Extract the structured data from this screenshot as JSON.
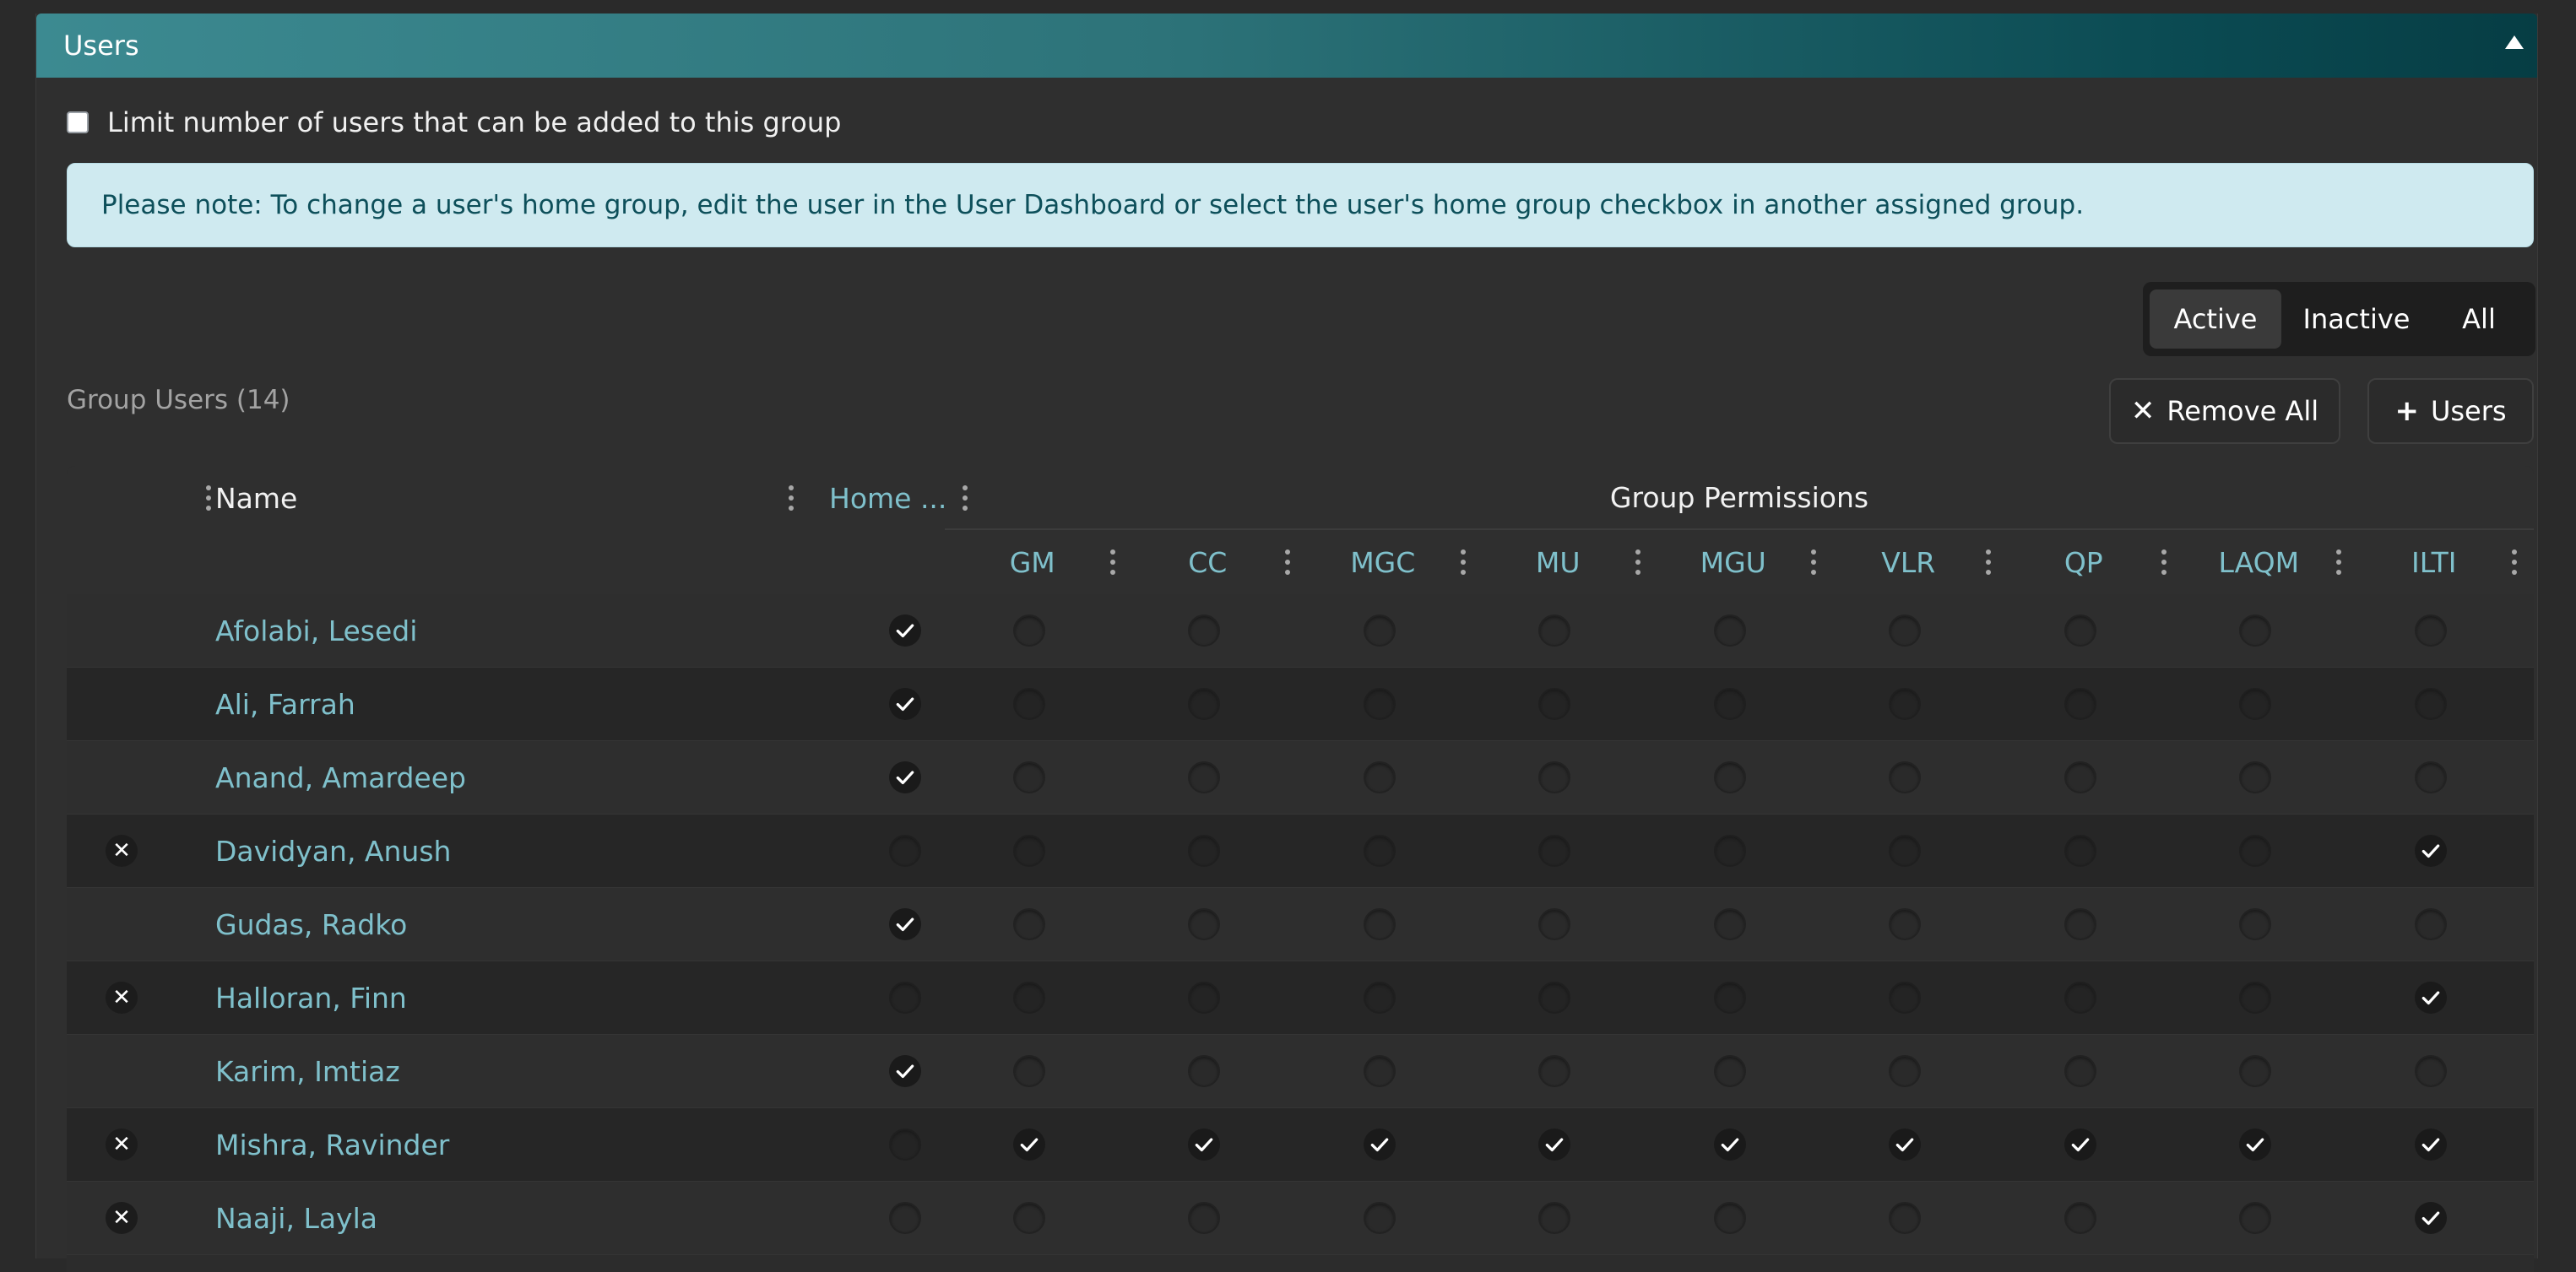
{
  "panel": {
    "title": "Users"
  },
  "limit": {
    "label": "Limit number of users that can be added to this group"
  },
  "note": "Please note: To change a user's home group, edit the user in the User Dashboard or select the user's home group checkbox in another assigned group.",
  "filter": {
    "active": "Active",
    "inactive": "Inactive",
    "all": "All"
  },
  "group_users_label": "Group Users (14)",
  "buttons": {
    "remove_all": "Remove All",
    "add_users": "Users"
  },
  "table": {
    "name_header": "Name",
    "home_header": "Home ...",
    "group_permissions_header": "Group Permissions",
    "permissions": [
      "GM",
      "CC",
      "MGC",
      "MU",
      "MGU",
      "VLR",
      "QP",
      "LAQM",
      "ILTI"
    ],
    "rows": [
      {
        "name": "Afolabi, Lesedi",
        "removable": false,
        "home": true,
        "perms": [
          0,
          0,
          0,
          0,
          0,
          0,
          0,
          0,
          0
        ]
      },
      {
        "name": "Ali, Farrah",
        "removable": false,
        "home": true,
        "perms": [
          0,
          0,
          0,
          0,
          0,
          0,
          0,
          0,
          0
        ]
      },
      {
        "name": "Anand, Amardeep",
        "removable": false,
        "home": true,
        "perms": [
          0,
          0,
          0,
          0,
          0,
          0,
          0,
          0,
          0
        ]
      },
      {
        "name": "Davidyan, Anush",
        "removable": true,
        "home": false,
        "perms": [
          0,
          0,
          0,
          0,
          0,
          0,
          0,
          0,
          1
        ]
      },
      {
        "name": "Gudas, Radko",
        "removable": false,
        "home": true,
        "perms": [
          0,
          0,
          0,
          0,
          0,
          0,
          0,
          0,
          0
        ]
      },
      {
        "name": "Halloran, Finn",
        "removable": true,
        "home": false,
        "perms": [
          0,
          0,
          0,
          0,
          0,
          0,
          0,
          0,
          1
        ]
      },
      {
        "name": "Karim, Imtiaz",
        "removable": false,
        "home": true,
        "perms": [
          0,
          0,
          0,
          0,
          0,
          0,
          0,
          0,
          0
        ]
      },
      {
        "name": "Mishra, Ravinder",
        "removable": true,
        "home": false,
        "perms": [
          1,
          1,
          1,
          1,
          1,
          1,
          1,
          1,
          1
        ]
      },
      {
        "name": "Naaji, Layla",
        "removable": true,
        "home": false,
        "perms": [
          0,
          0,
          0,
          0,
          0,
          0,
          0,
          0,
          1
        ]
      }
    ]
  },
  "colors": {
    "accent": "#7fc0cb",
    "header_start": "#3c8a91",
    "header_end": "#063d44",
    "note_bg": "#cfeaf0"
  }
}
